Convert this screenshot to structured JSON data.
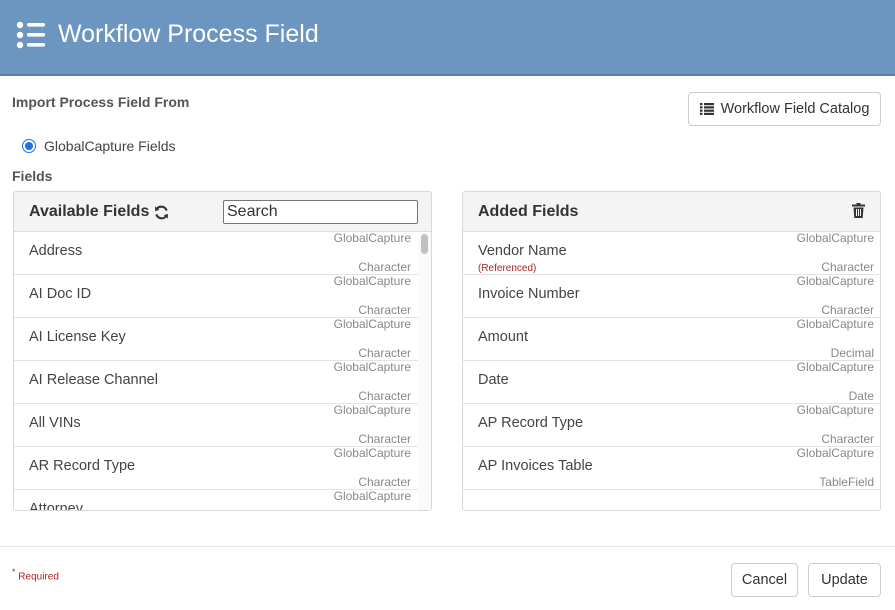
{
  "header": {
    "title": "Workflow Process Field",
    "icon": "menu-list-icon"
  },
  "import": {
    "label": "Import Process Field From",
    "catalog_button": "Workflow Field Catalog",
    "radio_label": "GlobalCapture Fields",
    "radio_selected": true
  },
  "fields_label": "Fields",
  "available": {
    "title": "Available Fields",
    "search_placeholder": "Search",
    "rows": [
      {
        "name": "Address",
        "source": "GlobalCapture",
        "type": "Character"
      },
      {
        "name": "AI Doc ID",
        "source": "GlobalCapture",
        "type": "Character"
      },
      {
        "name": "AI License Key",
        "source": "GlobalCapture",
        "type": "Character"
      },
      {
        "name": "AI Release Channel",
        "source": "GlobalCapture",
        "type": "Character"
      },
      {
        "name": "All VINs",
        "source": "GlobalCapture",
        "type": "Character"
      },
      {
        "name": "AR Record Type",
        "source": "GlobalCapture",
        "type": "Character"
      },
      {
        "name": "Attorney",
        "source": "GlobalCapture",
        "type": ""
      }
    ]
  },
  "added": {
    "title": "Added Fields",
    "rows": [
      {
        "name": "Vendor Name",
        "ref": "(Referenced)",
        "source": "GlobalCapture",
        "type": "Character"
      },
      {
        "name": "Invoice Number",
        "ref": "",
        "source": "GlobalCapture",
        "type": "Character"
      },
      {
        "name": "Amount",
        "ref": "",
        "source": "GlobalCapture",
        "type": "Decimal"
      },
      {
        "name": "Date",
        "ref": "",
        "source": "GlobalCapture",
        "type": "Date"
      },
      {
        "name": "AP Record Type",
        "ref": "",
        "source": "GlobalCapture",
        "type": "Character"
      },
      {
        "name": "AP Invoices Table",
        "ref": "",
        "source": "GlobalCapture",
        "type": "TableField"
      }
    ]
  },
  "footer": {
    "required_mark": "*",
    "required_text": "Required",
    "cancel": "Cancel",
    "update": "Update"
  },
  "colors": {
    "header": "#6c95c0",
    "required": "#b22222",
    "radio": "#1a73e8"
  }
}
